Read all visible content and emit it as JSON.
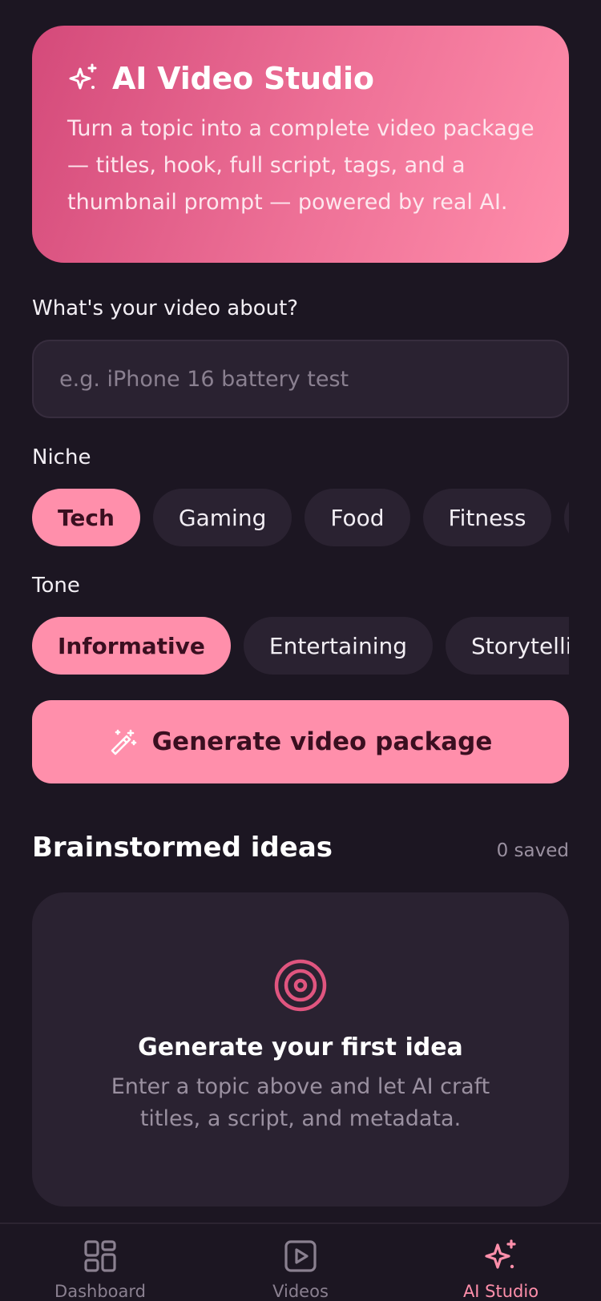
{
  "hero": {
    "icon": "sparkles-icon",
    "title": "AI Video Studio",
    "description": "Turn a topic into a complete video package — titles, hook, full script, tags, and a thumbnail prompt — powered by real AI."
  },
  "topic": {
    "label": "What's your video about?",
    "value": "",
    "placeholder": "e.g. iPhone 16 battery test"
  },
  "niche": {
    "label": "Niche",
    "options": [
      "Tech",
      "Gaming",
      "Food",
      "Fitness"
    ],
    "selected": "Tech"
  },
  "tone": {
    "label": "Tone",
    "options": [
      "Informative",
      "Entertaining",
      "Storytelling"
    ],
    "selected": "Informative"
  },
  "generate": {
    "icon": "magic-wand-icon",
    "label": "Generate video package"
  },
  "ideas": {
    "title": "Brainstormed ideas",
    "count_label": "0 saved",
    "empty": {
      "icon": "target-icon",
      "title": "Generate your first idea",
      "description": "Enter a topic above and let AI craft titles, a script, and metadata."
    }
  },
  "nav": {
    "items": [
      {
        "label": "Dashboard",
        "icon": "grid-icon",
        "active": false
      },
      {
        "label": "Videos",
        "icon": "play-square-icon",
        "active": false
      },
      {
        "label": "AI Studio",
        "icon": "sparkles-icon",
        "active": true
      }
    ]
  },
  "colors": {
    "background": "#1c1622",
    "card": "#2a2231",
    "accent": "#ff8fab",
    "accent_dark": "#d44a7a"
  }
}
